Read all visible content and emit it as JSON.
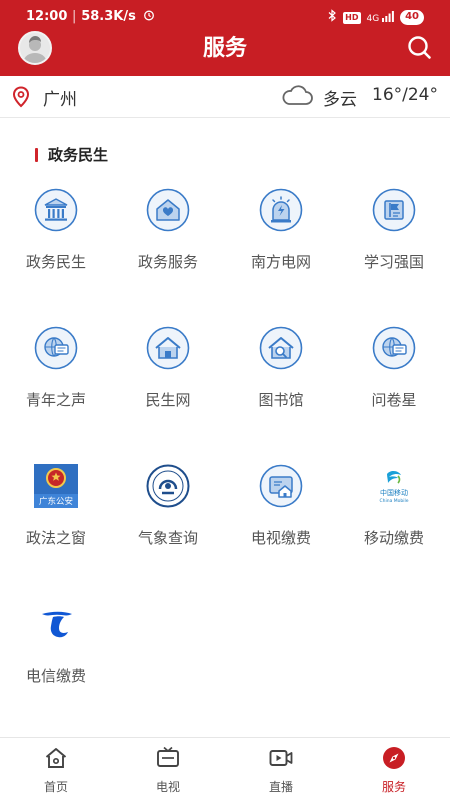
{
  "status_bar": {
    "time": "12:00",
    "speed": "58.3K/s",
    "network": "4G",
    "hd": "HD",
    "battery": "40"
  },
  "header": {
    "title": "服务",
    "avatar_icon": "user-avatar-icon",
    "search_icon": "search-icon",
    "bg_color": "#c81e24"
  },
  "location": {
    "city": "广州",
    "weather": "多云",
    "temperature": "16°/24°"
  },
  "section": {
    "title": "政务民生",
    "accent_color": "#d0242b"
  },
  "services": [
    {
      "label": "政务民生",
      "icon": "government-building-icon"
    },
    {
      "label": "政务服务",
      "icon": "home-heart-icon"
    },
    {
      "label": "南方电网",
      "icon": "power-alarm-icon"
    },
    {
      "label": "学习强国",
      "icon": "study-flag-icon"
    },
    {
      "label": "青年之声",
      "icon": "globe-chat-icon"
    },
    {
      "label": "民生网",
      "icon": "house-icon"
    },
    {
      "label": "图书馆",
      "icon": "library-search-icon"
    },
    {
      "label": "问卷星",
      "icon": "globe-survey-icon"
    },
    {
      "label": "政法之窗",
      "icon": "police-emblem-icon"
    },
    {
      "label": "气象查询",
      "icon": "weather-bureau-logo-icon"
    },
    {
      "label": "电视缴费",
      "icon": "tv-payment-icon"
    },
    {
      "label": "移动缴费",
      "icon": "china-mobile-logo-icon"
    },
    {
      "label": "电信缴费",
      "icon": "china-telecom-logo-icon"
    }
  ],
  "logo_text": {
    "police": "广东公安",
    "mobile_cn": "中国移动",
    "mobile_en": "China Mobile"
  },
  "bottom_nav": [
    {
      "label": "首页",
      "icon": "home-icon",
      "active": false
    },
    {
      "label": "电视",
      "icon": "tv-icon",
      "active": false
    },
    {
      "label": "直播",
      "icon": "live-video-icon",
      "active": false
    },
    {
      "label": "服务",
      "icon": "compass-icon",
      "active": true
    }
  ]
}
